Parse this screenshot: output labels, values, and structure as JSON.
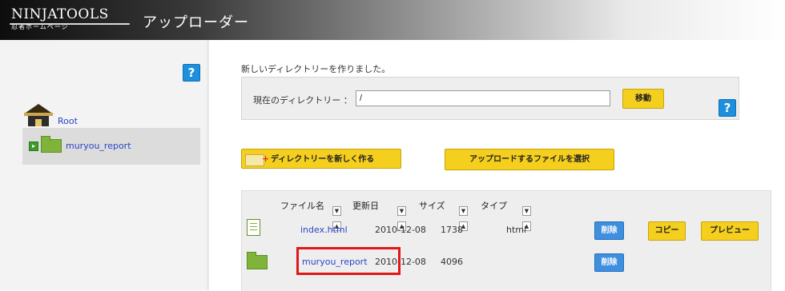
{
  "header": {
    "logo_main": "NINJATOOLS",
    "logo_sub": "忍者ホームページ",
    "app_title": "アップローダー"
  },
  "sidebar": {
    "help_label": "?",
    "tree": [
      {
        "label": "Root",
        "icon": "house-icon"
      },
      {
        "label": "muryou_report",
        "icon": "folder-icon",
        "selected": true
      }
    ]
  },
  "main": {
    "status_message": "新しいディレクトリーを作りました。",
    "current_dir_label": "現在のディレクトリー ：",
    "current_dir_value": "/",
    "move_button": "移動",
    "help_label": "?",
    "new_dir_button": "ディレクトリーを新しく作る",
    "upload_button": "アップロードするファイルを選択",
    "columns": [
      "ファイル名",
      "更新日",
      "サイズ",
      "タイプ"
    ],
    "sort_down": "▼",
    "sort_up": "▲",
    "files": [
      {
        "name": "index.html",
        "date": "2010-12-08",
        "size": "1738",
        "type": "html",
        "actions": [
          "削除",
          "コピー",
          "プレビュー"
        ]
      },
      {
        "name": "muryou_report",
        "date": "2010-12-08",
        "size": "4096",
        "type": "",
        "actions": [
          "削除"
        ]
      }
    ]
  },
  "colors": {
    "accent_yellow": "#f5cf1e",
    "action_blue": "#3f8fde",
    "link_blue": "#2a45c6",
    "highlight_red": "#e01818"
  }
}
